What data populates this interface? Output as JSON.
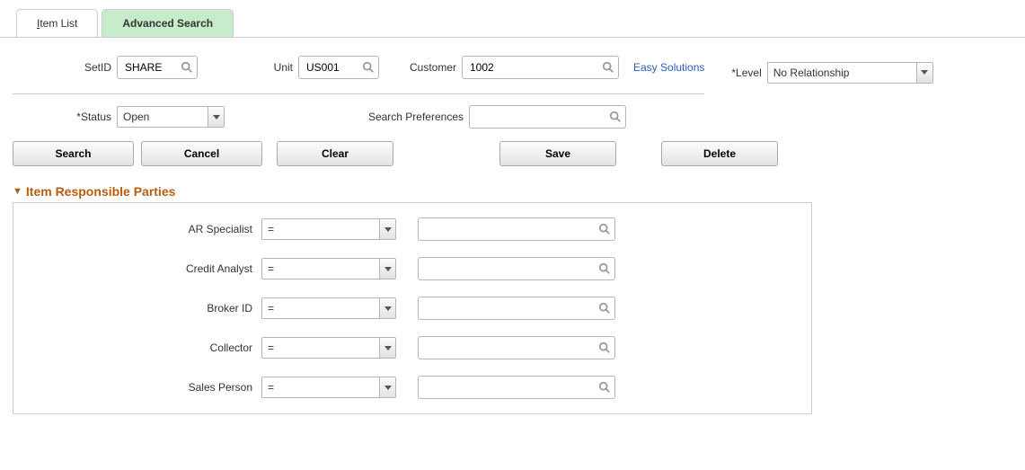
{
  "tabs": {
    "item_list": "Item List",
    "advanced_search": "Advanced Search"
  },
  "row1": {
    "setid_label": "SetID",
    "setid_value": "SHARE",
    "unit_label": "Unit",
    "unit_value": "US001",
    "customer_label": "Customer",
    "customer_value": "1002",
    "easy_solutions": "Easy Solutions",
    "level_label": "*Level",
    "level_value": "No Relationship"
  },
  "row2": {
    "status_label": "*Status",
    "status_value": "Open",
    "search_pref_label": "Search Preferences",
    "search_pref_value": ""
  },
  "buttons": {
    "search": "Search",
    "cancel": "Cancel",
    "clear": "Clear",
    "save": "Save",
    "delete": "Delete"
  },
  "section": {
    "title": "Item Responsible Parties",
    "rows": [
      {
        "label": "AR Specialist",
        "op": "=",
        "val": ""
      },
      {
        "label": "Credit Analyst",
        "op": "=",
        "val": ""
      },
      {
        "label": "Broker ID",
        "op": "=",
        "val": ""
      },
      {
        "label": "Collector",
        "op": "=",
        "val": ""
      },
      {
        "label": "Sales Person",
        "op": "=",
        "val": ""
      }
    ]
  }
}
